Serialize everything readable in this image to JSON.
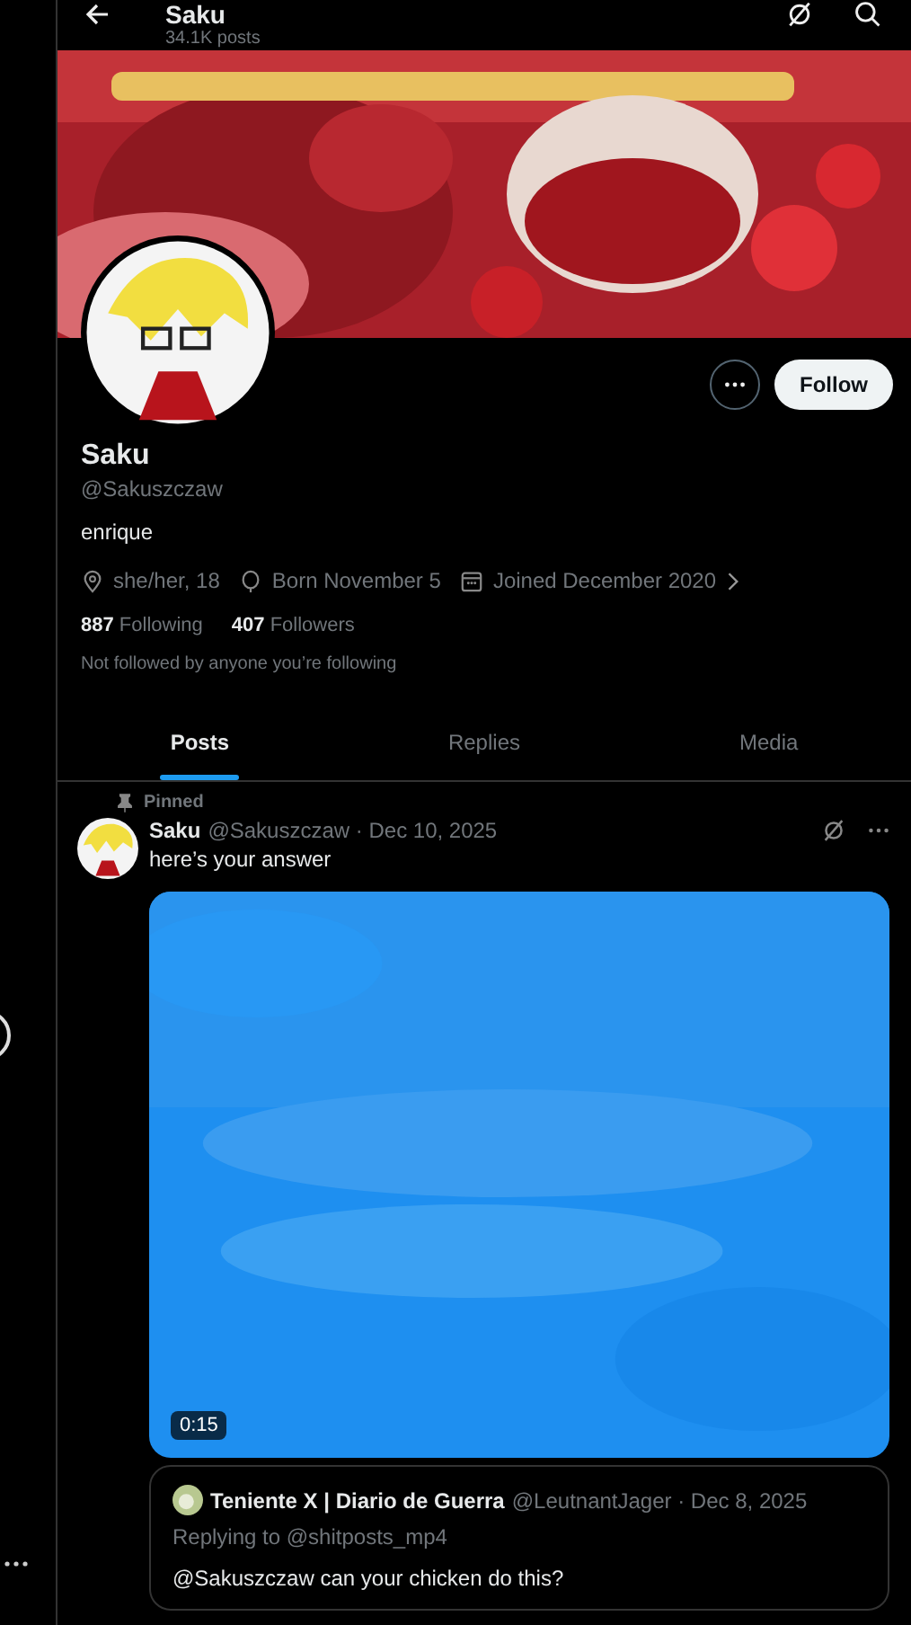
{
  "header": {
    "title": "Saku",
    "subtitle": "34.1K posts"
  },
  "profile": {
    "name": "Saku",
    "handle": "@Sakuszczaw",
    "bio": "enrique",
    "follow_button": "Follow",
    "details": [
      {
        "kind": "location",
        "text": "she/her, 18"
      },
      {
        "kind": "birthday",
        "text": "Born November 5"
      },
      {
        "kind": "joined",
        "text": "Joined December 2020"
      }
    ],
    "stats": [
      {
        "count": "887",
        "label": "Following"
      },
      {
        "count": "407",
        "label": "Followers"
      }
    ],
    "followed_by": "Not followed by anyone you’re following"
  },
  "tabs": [
    {
      "label": "Posts",
      "selected": true
    },
    {
      "label": "Replies",
      "selected": false
    },
    {
      "label": "Media",
      "selected": false
    }
  ],
  "post": {
    "pinned_label": "Pinned",
    "author": "Saku",
    "meta": "@Sakuszczaw · Dec 10, 2025",
    "text": "here’s your answer",
    "video_duration": "0:15",
    "quote": {
      "author": "Teniente X | Diario de Guerra",
      "meta": "@LeutnantJager · Dec 8, 2025",
      "replying": "Replying to @shitposts_mp4",
      "text": "@Sakuszczaw can your chicken do this?"
    }
  }
}
